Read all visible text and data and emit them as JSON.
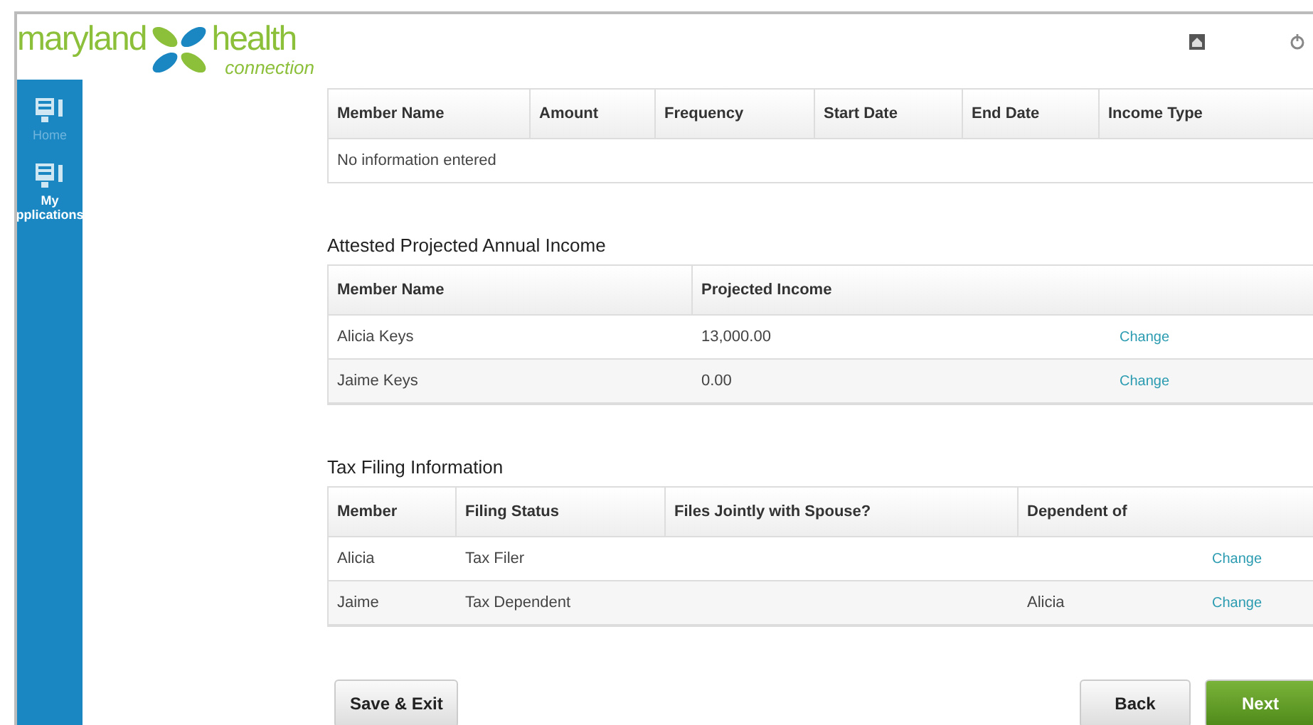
{
  "logo": {
    "first": "maryland",
    "second": "health",
    "third": "connection"
  },
  "sidebar": {
    "items": [
      {
        "label": "Home",
        "selected": false
      },
      {
        "label": "My",
        "label2": "pplications",
        "selected": true
      }
    ]
  },
  "income_table": {
    "columns": [
      "Member Name",
      "Amount",
      "Frequency",
      "Start Date",
      "End Date",
      "Income Type"
    ],
    "empty": "No information entered"
  },
  "projected_income": {
    "title": "Attested Projected Annual Income",
    "columns": [
      "Member Name",
      "Projected Income"
    ],
    "rows": [
      {
        "cells": [
          "Alicia Keys",
          "13,000.00"
        ],
        "action": "Change"
      },
      {
        "cells": [
          "Jaime Keys",
          "0.00"
        ],
        "action": "Change"
      }
    ]
  },
  "tax_filing": {
    "title": "Tax Filing Information",
    "columns": [
      "Member",
      "Filing Status",
      "Files Jointly with Spouse?",
      "Dependent of"
    ],
    "rows": [
      {
        "cells": [
          "Alicia",
          "Tax Filer",
          null,
          null
        ],
        "action": "Change"
      },
      {
        "cells": [
          "Jaime",
          "Tax Dependent",
          null,
          "Alicia"
        ],
        "action": "Change"
      }
    ]
  },
  "buttons": {
    "save": "Save & Exit",
    "back": "Back",
    "next": "Next"
  }
}
